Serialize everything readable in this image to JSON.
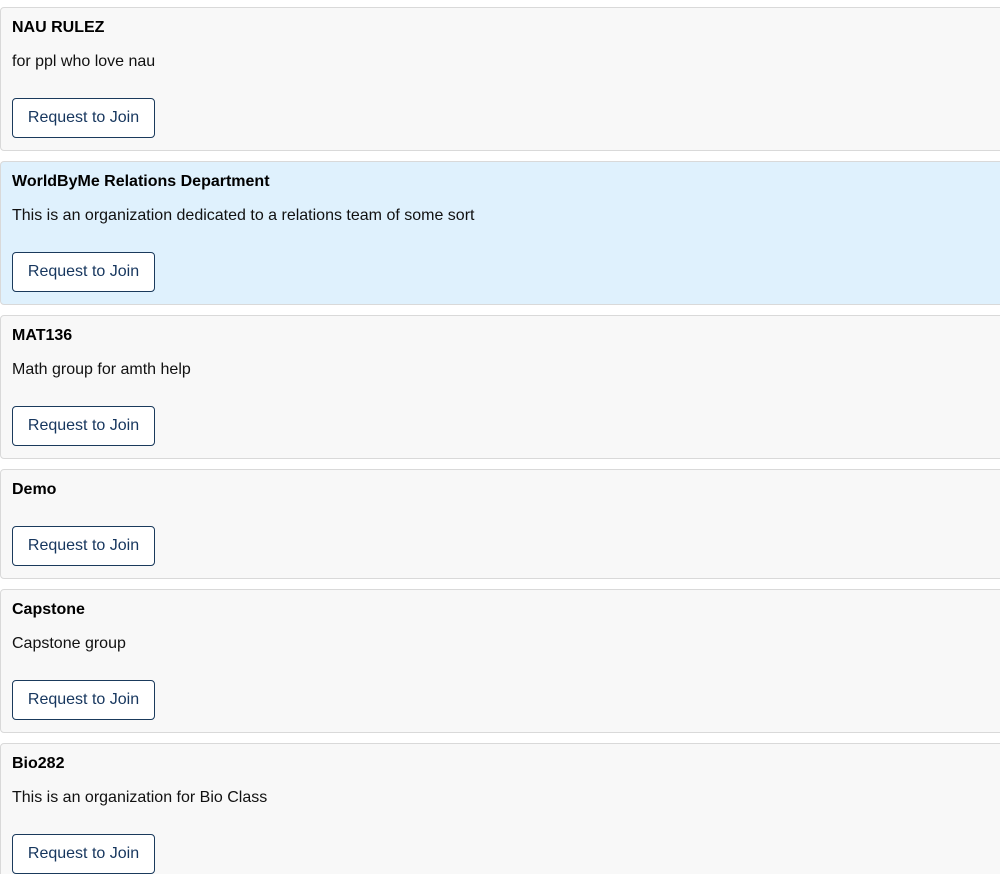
{
  "organizations": [
    {
      "name": "NAU RULEZ",
      "description": "for ppl who love nau",
      "button_label": "Request to Join"
    },
    {
      "name": "WorldByMe Relations Department",
      "description": "This is an organization dedicated to a relations team of some sort",
      "button_label": "Request to Join",
      "highlighted": true
    },
    {
      "name": "MAT136",
      "description": "Math group for amth help",
      "button_label": "Request to Join"
    },
    {
      "name": "Demo",
      "description": "",
      "button_label": "Request to Join"
    },
    {
      "name": "Capstone",
      "description": "Capstone group",
      "button_label": "Request to Join"
    },
    {
      "name": "Bio282",
      "description": "This is an organization for Bio Class",
      "button_label": "Request to Join"
    }
  ],
  "colors": {
    "card_background": "#f8f8f8",
    "card_highlight_background": "#dff1fd",
    "card_border": "#d9d9d9",
    "button_border": "#1a3a5c",
    "button_text": "#16365e"
  }
}
